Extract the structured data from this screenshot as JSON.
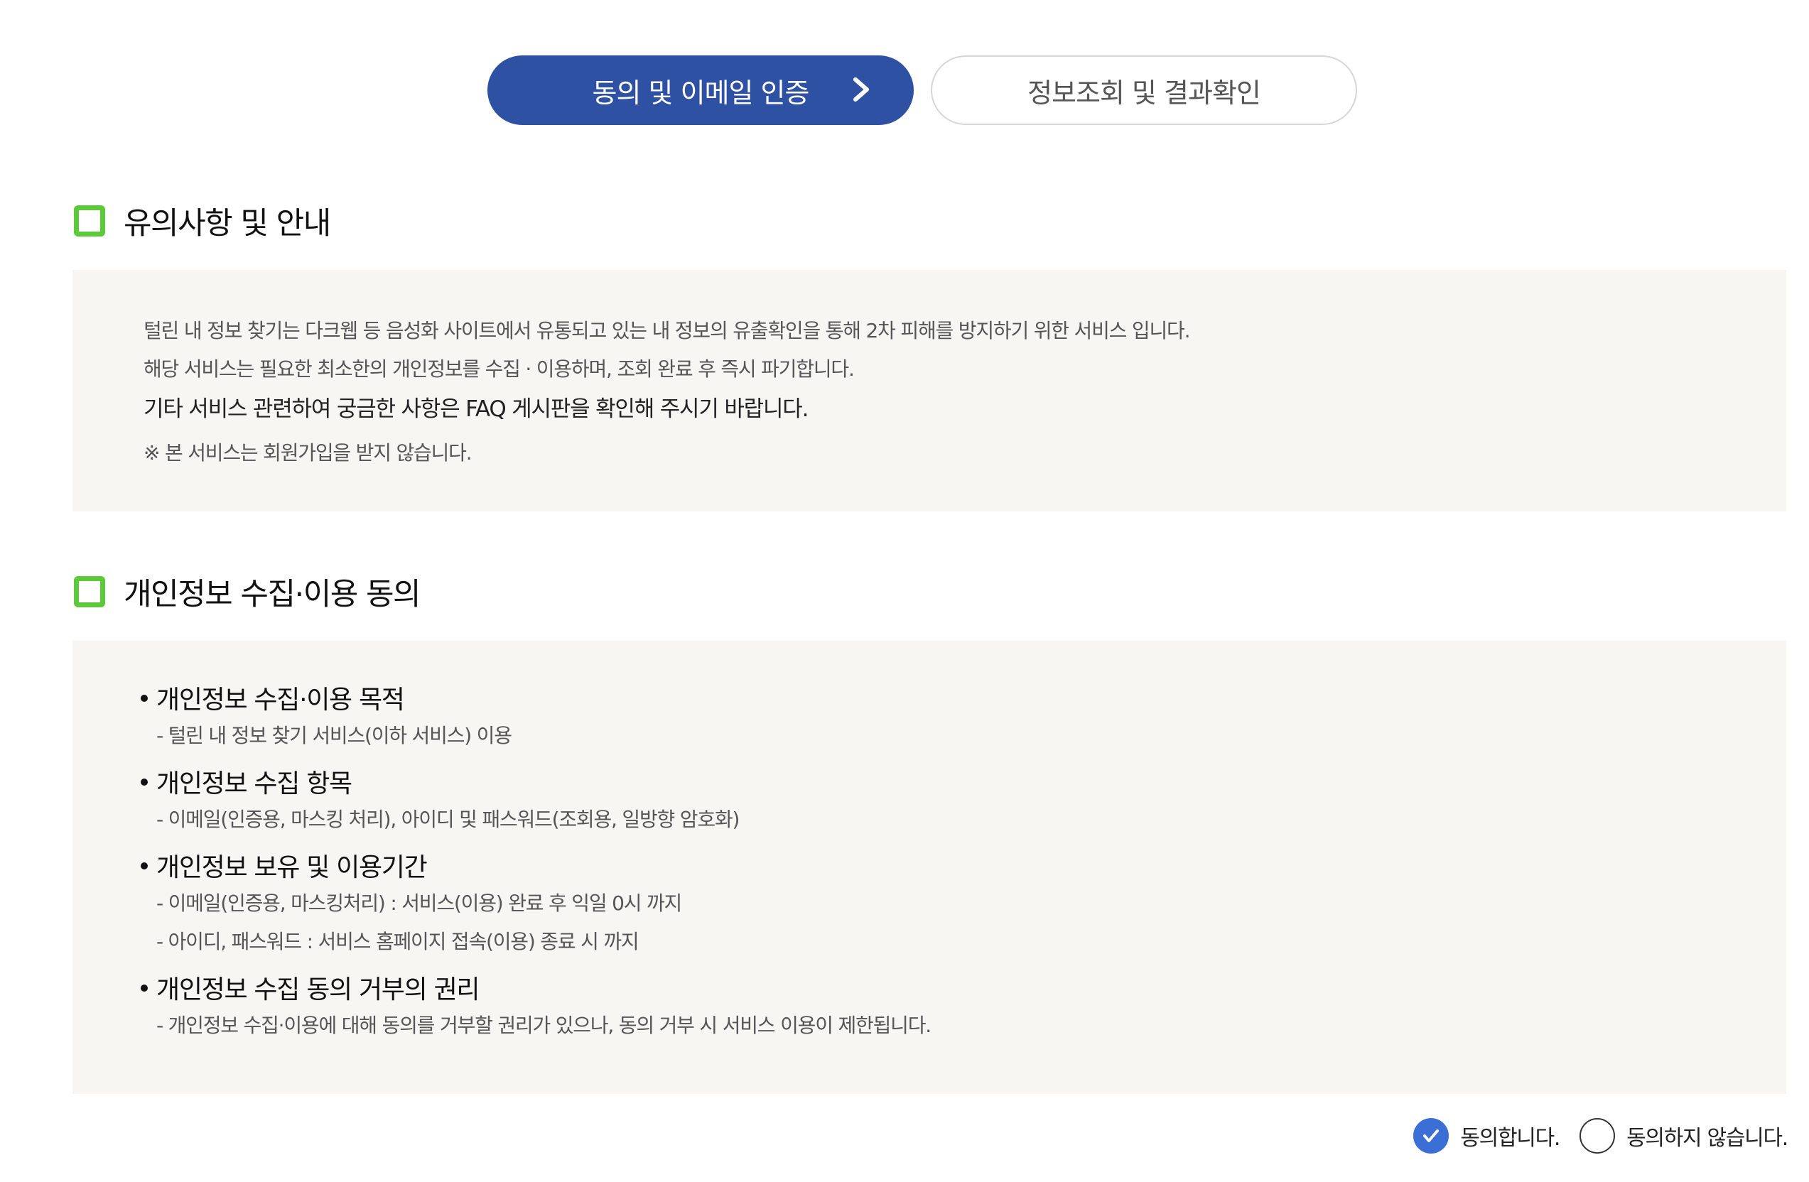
{
  "steps": [
    {
      "label": "동의 및 이메일 인증",
      "active": true
    },
    {
      "label": "정보조회 및 결과확인",
      "active": false
    }
  ],
  "notice": {
    "title": "유의사항 및 안내",
    "lines": [
      "털린 내 정보 찾기는 다크웹 등 음성화 사이트에서 유통되고 있는 내 정보의 유출확인을 통해 2차 피해를 방지하기 위한 서비스 입니다.",
      "해당 서비스는 필요한 최소한의 개인정보를 수집 · 이용하며, 조회 완료 후 즉시 파기합니다.",
      "기타 서비스 관련하여 궁금한 사항은 FAQ 게시판을 확인해 주시기 바랍니다.",
      "※ 본 서비스는 회원가입을 받지 않습니다."
    ]
  },
  "consent": {
    "title": "개인정보 수집·이용 동의",
    "items": [
      {
        "title": "개인정보 수집·이용 목적",
        "subs": [
          "- 털린 내 정보 찾기 서비스(이하 서비스) 이용"
        ]
      },
      {
        "title": "개인정보 수집 항목",
        "subs": [
          "- 이메일(인증용, 마스킹 처리), 아이디 및 패스워드(조회용, 일방향 암호화)"
        ]
      },
      {
        "title": "개인정보 보유 및 이용기간",
        "subs": [
          "- 이메일(인증용, 마스킹처리) : 서비스(이용) 완료 후 익일 0시 까지",
          "- 아이디, 패스워드 : 서비스 홈페이지 접속(이용) 종료 시 까지"
        ]
      },
      {
        "title": "개인정보 수집 동의 거부의 권리",
        "subs": [
          "- 개인정보 수집·이용에 대해 동의를 거부할 권리가 있으나, 동의 거부 시 서비스 이용이 제한됩니다."
        ]
      }
    ]
  },
  "agreement": {
    "agree_label": "동의합니다.",
    "disagree_label": "동의하지 않습니다.",
    "selected": "agree"
  },
  "colors": {
    "accent": "#2e51a3",
    "section_marker": "#5cc93a",
    "radio_on": "#3b6fd6",
    "box_bg": "#f8f6f2"
  }
}
